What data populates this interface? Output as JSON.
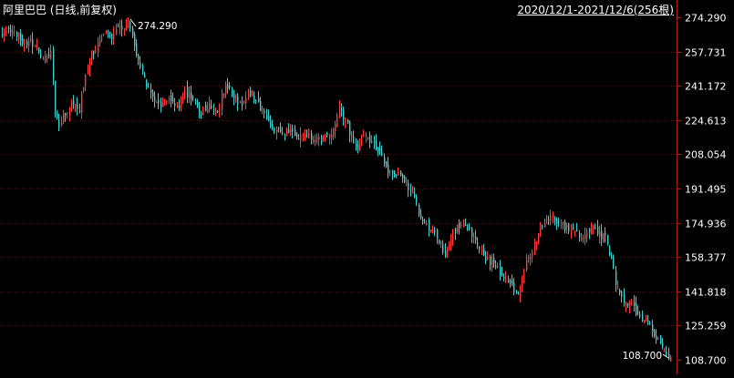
{
  "header": {
    "title": "阿里巴巴 (日线,前复权)",
    "range": "2020/12/1-2021/12/6(256根)"
  },
  "colors": {
    "background": "#000000",
    "up": "#ff3b3b",
    "down": "#3fd0d0",
    "grid": "#5a1414",
    "axis": "#aa2020",
    "text": "#ffffff"
  },
  "chart_data": {
    "type": "candlestick",
    "title": "阿里巴巴 (日线,前复权)",
    "date_range": "2020/12/1-2021/12/6",
    "bar_count": 256,
    "ylim": [
      108.7,
      274.29
    ],
    "y_ticks": [
      "274.290",
      "257.731",
      "241.172",
      "224.613",
      "208.054",
      "191.495",
      "174.936",
      "158.377",
      "141.818",
      "125.259",
      "108.700"
    ],
    "y_tick_values": [
      274.29,
      257.731,
      241.172,
      224.613,
      208.054,
      191.495,
      174.936,
      158.377,
      141.818,
      125.259,
      108.7
    ],
    "close_path": [
      [
        0,
        266
      ],
      [
        6,
        268
      ],
      [
        10,
        263
      ],
      [
        14,
        262
      ],
      [
        18,
        259
      ],
      [
        20,
        254
      ],
      [
        24,
        258
      ],
      [
        26,
        230
      ],
      [
        28,
        222
      ],
      [
        34,
        234
      ],
      [
        38,
        230
      ],
      [
        40,
        242
      ],
      [
        44,
        256
      ],
      [
        48,
        262
      ],
      [
        52,
        268
      ],
      [
        54,
        265
      ],
      [
        58,
        269
      ],
      [
        62,
        272
      ],
      [
        66,
        256
      ],
      [
        70,
        244
      ],
      [
        74,
        235
      ],
      [
        78,
        232
      ],
      [
        82,
        236
      ],
      [
        86,
        230
      ],
      [
        90,
        238
      ],
      [
        94,
        234
      ],
      [
        98,
        228
      ],
      [
        102,
        232
      ],
      [
        106,
        230
      ],
      [
        110,
        242
      ],
      [
        114,
        236
      ],
      [
        118,
        232
      ],
      [
        122,
        238
      ],
      [
        126,
        232
      ],
      [
        130,
        226
      ],
      [
        134,
        220
      ],
      [
        138,
        218
      ],
      [
        142,
        220
      ],
      [
        146,
        216
      ],
      [
        150,
        218
      ],
      [
        154,
        216
      ],
      [
        158,
        214
      ],
      [
        162,
        218
      ],
      [
        166,
        230
      ],
      [
        170,
        222
      ],
      [
        174,
        210
      ],
      [
        178,
        218
      ],
      [
        182,
        214
      ],
      [
        186,
        210
      ],
      [
        190,
        200
      ],
      [
        194,
        198
      ],
      [
        198,
        194
      ],
      [
        202,
        190
      ],
      [
        206,
        178
      ],
      [
        210,
        172
      ],
      [
        214,
        168
      ],
      [
        218,
        160
      ],
      [
        222,
        170
      ],
      [
        226,
        175
      ],
      [
        230,
        170
      ],
      [
        234,
        164
      ],
      [
        238,
        158
      ],
      [
        242,
        155
      ],
      [
        246,
        150
      ],
      [
        250,
        145
      ],
      [
        254,
        140
      ],
      [
        258,
        155
      ],
      [
        262,
        165
      ],
      [
        266,
        172
      ],
      [
        270,
        180
      ],
      [
        274,
        175
      ],
      [
        278,
        172
      ],
      [
        282,
        170
      ],
      [
        286,
        168
      ],
      [
        290,
        172
      ],
      [
        294,
        170
      ],
      [
        298,
        166
      ],
      [
        302,
        146
      ],
      [
        306,
        138
      ],
      [
        310,
        134
      ],
      [
        314,
        130
      ],
      [
        318,
        126
      ],
      [
        322,
        120
      ],
      [
        326,
        112
      ],
      [
        329,
        108.7
      ]
    ],
    "annotations": [
      {
        "label": "274.290",
        "value": 274.29,
        "type": "high"
      },
      {
        "label": "108.700",
        "value": 108.7,
        "type": "low"
      }
    ]
  }
}
